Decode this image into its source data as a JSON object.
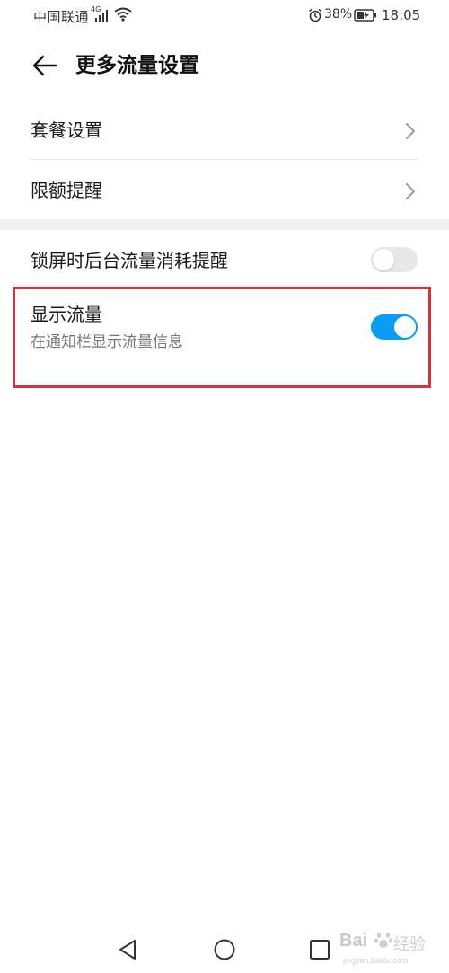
{
  "status_bar": {
    "carrier": "中国联通",
    "network_type": "4G",
    "battery_percent": "38%",
    "time": "18:05",
    "icons": [
      "signal-icon",
      "wifi-icon",
      "alarm-icon",
      "battery-charging-icon"
    ]
  },
  "header": {
    "title": "更多流量设置",
    "back_icon": "arrow-left-icon"
  },
  "settings": {
    "plan_settings": {
      "label": "套餐设置",
      "icon": "chevron-right-icon"
    },
    "limit_reminder": {
      "label": "限额提醒",
      "icon": "chevron-right-icon"
    },
    "lockscreen_reminder": {
      "label": "锁屏时后台流量消耗提醒",
      "enabled": false
    },
    "show_traffic": {
      "label": "显示流量",
      "description": "在通知栏显示流量信息",
      "enabled": true
    }
  },
  "nav_bar": {
    "icons": [
      "nav-back-icon",
      "nav-home-icon",
      "nav-recents-icon"
    ]
  },
  "watermark": {
    "brand": "Bai",
    "cn": "经验",
    "url": "jingyan.baidu.com"
  },
  "colors": {
    "toggle_on": "#0a9cf5",
    "toggle_off": "#e7e7e7",
    "highlight_border": "#d7323c",
    "section_gap": "#f2f2f2"
  }
}
